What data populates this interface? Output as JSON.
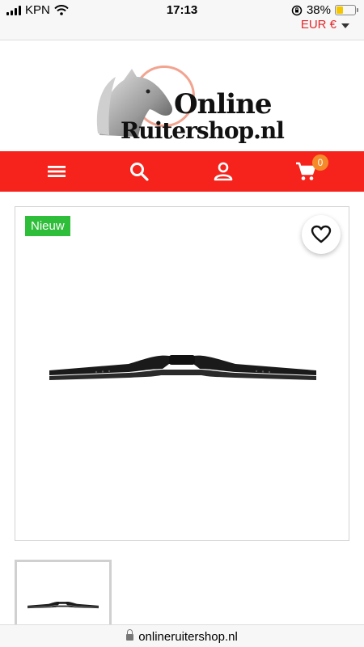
{
  "status_bar": {
    "carrier": "KPN",
    "time": "17:13",
    "battery_percent": "38%",
    "battery_level": 0.38
  },
  "header": {
    "currency": "EUR €"
  },
  "logo": {
    "line1": "Online",
    "line2": "Ruitershop.nl"
  },
  "nav": {
    "icons": [
      "menu-icon",
      "search-icon",
      "user-icon",
      "cart-icon"
    ],
    "cart_count": "0"
  },
  "product": {
    "badge": "Nieuw"
  },
  "browser": {
    "url": "onlineruitershop.nl"
  }
}
